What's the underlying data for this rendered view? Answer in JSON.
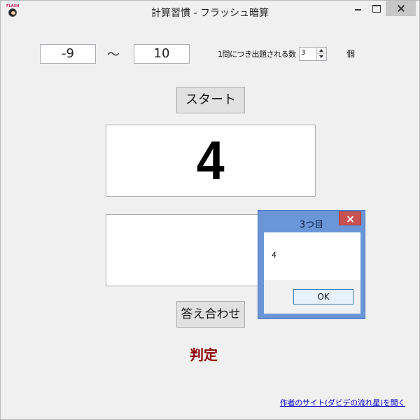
{
  "window": {
    "title": "計算習慣 - フラッシュ暗算",
    "icon_text": "FLASH"
  },
  "range": {
    "min": "-9",
    "separator": "～",
    "max": "10"
  },
  "count": {
    "label": "1問につき出題される数",
    "value": "3",
    "unit": "個"
  },
  "buttons": {
    "start": "スタート",
    "check": "答え合わせ"
  },
  "display": {
    "number": "4"
  },
  "answer": {
    "value": ""
  },
  "judge": {
    "label": "判定"
  },
  "footer": {
    "author_link": "作者のサイト(ダビデの流れ星)を開く"
  },
  "dialog": {
    "title": "3つ目",
    "message": "4",
    "ok_label": "OK"
  },
  "colors": {
    "judge": "#8b0000",
    "link": "#0000cc",
    "dialog_frame": "#6a96d8",
    "dialog_close": "#c75050"
  }
}
